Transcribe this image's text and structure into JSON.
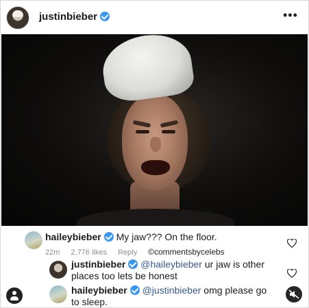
{
  "post": {
    "username": "justinbieber",
    "more_icon": "more-horizontal-icon"
  },
  "comments": [
    {
      "username": "haileybieber",
      "text": "My jaw??? On the floor.",
      "time": "22m",
      "likes": "2,776 likes",
      "reply_label": "Reply",
      "watermark": "©commentsbycelebs"
    },
    {
      "username": "justinbieber",
      "mention": "@haileybieber",
      "text": "ur jaw is other places too lets be honest"
    },
    {
      "username": "haileybieber",
      "mention": "@justinbieber",
      "text": "omg please go to sleep."
    }
  ],
  "colors": {
    "verified": "#3897f0",
    "mention": "#375a8c",
    "meta": "#8e8e8e"
  }
}
